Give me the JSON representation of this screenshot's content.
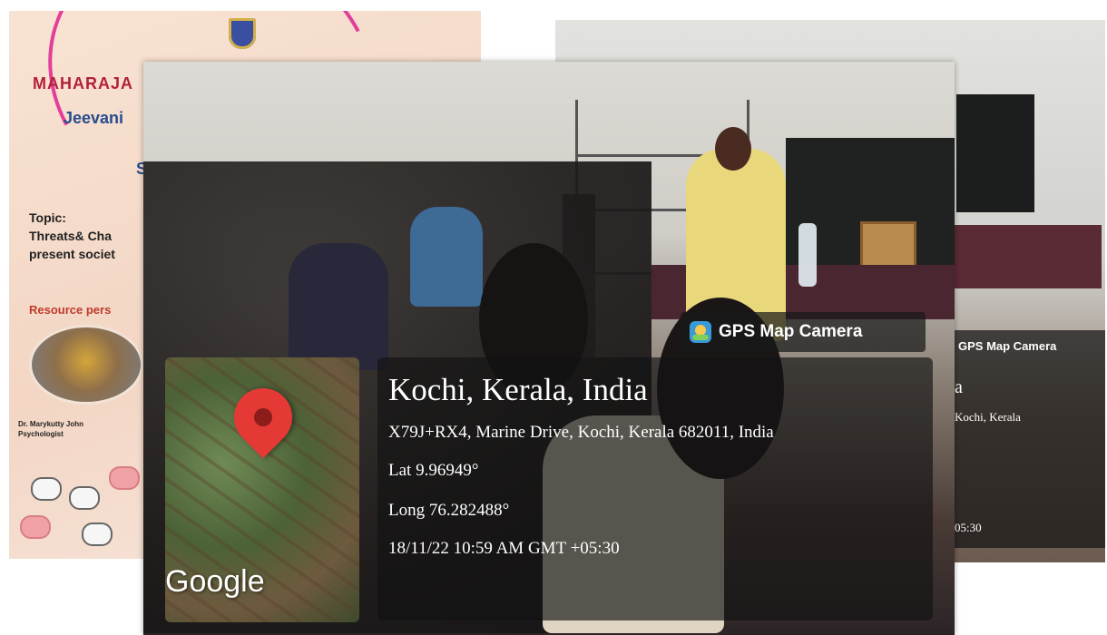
{
  "poster": {
    "line1": "MAHARAJA",
    "line2": "Jeevani",
    "line3": "S",
    "topic_label": "Topic:",
    "topic_line1": "Threats& Cha",
    "topic_line2": "present societ",
    "resource_label": "Resource pers",
    "speaker_name": "Dr. Marykutty John",
    "speaker_role": "Psychologist"
  },
  "front_gps": {
    "app_title": "GPS Map Camera",
    "city": "Kochi, Kerala, India",
    "address": "X79J+RX4, Marine Drive, Kochi, Kerala 682011, India",
    "latitude": "Lat 9.96949°",
    "longitude": "Long 76.282488°",
    "timestamp": "18/11/22 10:59 AM GMT +05:30",
    "map_logo": "Google"
  },
  "back_gps": {
    "app_title": "GPS Map Camera",
    "city_fragment": "a",
    "address_fragment": "Kochi, Kerala",
    "timestamp_fragment": "05:30"
  },
  "colors": {
    "poster_red": "#b2203a",
    "poster_blue": "#274c8f",
    "pin_red": "#e53935",
    "overlay": "#121212"
  }
}
